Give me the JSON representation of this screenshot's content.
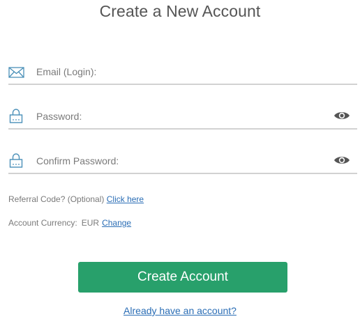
{
  "page": {
    "title": "Create a New Account"
  },
  "form": {
    "email": {
      "placeholder": "Email (Login):",
      "icon": "envelope-icon"
    },
    "password": {
      "placeholder": "Password:",
      "icon": "lock-icon",
      "toggle_icon": "eye-icon"
    },
    "confirm_password": {
      "placeholder": "Confirm Password:",
      "icon": "lock-icon",
      "toggle_icon": "eye-icon"
    },
    "referral": {
      "label": "Referral Code? (Optional)",
      "link": "Click here"
    },
    "currency": {
      "label": "Account Currency:",
      "value": "EUR",
      "link": "Change"
    },
    "submit_label": "Create Account",
    "login_link": "Already have an account?"
  },
  "colors": {
    "accent": "#28a06b",
    "link": "#2a6db5",
    "icon": "#4a90b8"
  }
}
